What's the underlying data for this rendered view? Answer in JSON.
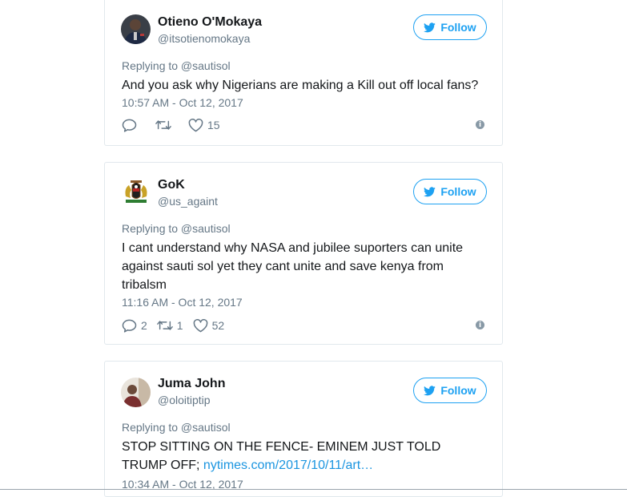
{
  "tweets": [
    {
      "name": "Otieno O'Mokaya",
      "handle": "@itsotienomokaya",
      "follow_label": "Follow",
      "replying_to": "Replying to @sautisol",
      "text": "And you ask why Nigerians are making a Kill out off local fans?",
      "link": "",
      "time": "10:57 AM - Oct 12, 2017",
      "replies": "",
      "retweets": "",
      "likes": "15"
    },
    {
      "name": "GoK",
      "handle": "@us_againt",
      "follow_label": "Follow",
      "replying_to": "Replying to @sautisol",
      "text": "I cant understand why NASA and jubilee suporters can unite against sauti sol yet they cant unite and save kenya from tribalsm",
      "link": "",
      "time": "11:16 AM - Oct 12, 2017",
      "replies": "2",
      "retweets": "1",
      "likes": "52"
    },
    {
      "name": "Juma John",
      "handle": "@oloitiptip",
      "follow_label": "Follow",
      "replying_to": "Replying to @sautisol",
      "text": "STOP SITTING ON THE FENCE- EMINEM JUST TOLD TRUMP OFF; ",
      "link": "nytimes.com/2017/10/11/art…",
      "time": "10:34 AM - Oct 12, 2017"
    }
  ],
  "colors": {
    "accent": "#1da1f2",
    "muted": "#657786",
    "border": "#e1e8ed"
  },
  "icons": [
    "twitter-bird-icon",
    "reply-icon",
    "retweet-icon",
    "heart-icon",
    "info-icon"
  ]
}
